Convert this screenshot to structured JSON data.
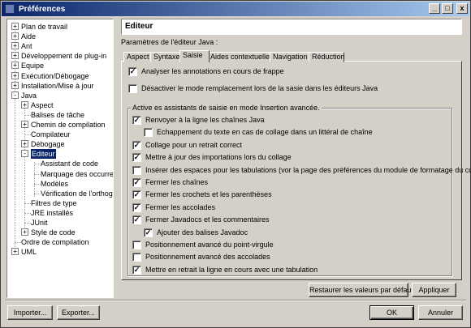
{
  "window": {
    "title": "Préférences",
    "minimize": "_",
    "maximize": "□",
    "close": "x"
  },
  "tree": [
    {
      "label": "Plan de travail",
      "expander": "+"
    },
    {
      "label": "Aide",
      "expander": "+"
    },
    {
      "label": "Ant",
      "expander": "+"
    },
    {
      "label": "Développement de plug-in",
      "expander": "+"
    },
    {
      "label": "Equipe",
      "expander": "+"
    },
    {
      "label": "Exécution/Débogage",
      "expander": "+"
    },
    {
      "label": "Installation/Mise à jour",
      "expander": "+"
    },
    {
      "label": "Java",
      "expander": "-"
    },
    {
      "label": "Aspect",
      "expander": "+"
    },
    {
      "label": "Balises de tâche",
      "expander": ""
    },
    {
      "label": "Chemin de compilation",
      "expander": "+"
    },
    {
      "label": "Compilateur",
      "expander": ""
    },
    {
      "label": "Débogage",
      "expander": "+"
    },
    {
      "label": "Editeur",
      "expander": "-"
    },
    {
      "label": "Assistant de code",
      "expander": ""
    },
    {
      "label": "Marquage des occurre",
      "expander": ""
    },
    {
      "label": "Modèles",
      "expander": ""
    },
    {
      "label": "Vérification de l'orthog",
      "expander": ""
    },
    {
      "label": "Filtres de type",
      "expander": ""
    },
    {
      "label": "JRE installés",
      "expander": ""
    },
    {
      "label": "JUnit",
      "expander": ""
    },
    {
      "label": "Style de code",
      "expander": "+"
    },
    {
      "label": "Ordre de compilation",
      "expander": ""
    },
    {
      "label": "UML",
      "expander": "+"
    }
  ],
  "page": {
    "heading": "Editeur",
    "params_label": "Paramètres de l'éditeur Java :"
  },
  "tabs": [
    "Aspect",
    "Syntaxe",
    "Saisie",
    "Aides contextuelles",
    "Navigation",
    "Réduction"
  ],
  "active_tab": "Saisie",
  "options": [
    {
      "label": "Analyser les annotations en cours de frappe",
      "checked": true
    },
    {
      "label": "Désactiver le mode remplacement lors de la sasie dans les éditeurs Java",
      "checked": false
    }
  ],
  "group": {
    "title": "Active es assistants de saisie en mode Insertion avancée.",
    "items": [
      {
        "label": "Renvoyer à la ligne les chaînes Java",
        "checked": true
      },
      {
        "label": "Echappement du texte en cas de collage dans un littéral de chaîne",
        "checked": false
      },
      {
        "label": "Collage pour un retrait correct",
        "checked": true
      },
      {
        "label": "Mettre à jour des importations lors du collage",
        "checked": true
      },
      {
        "label": "Insérer des espaces pour les tabulations (vor la page des préférences du module de formatage du code)",
        "checked": false
      },
      {
        "label": "Fermer les chaînes",
        "checked": true
      },
      {
        "label": "Fermer les crochets et les parenthèses",
        "checked": true
      },
      {
        "label": "Fermer les accolades",
        "checked": true
      },
      {
        "label": "Fermer Javadocs et les commentaires",
        "checked": true
      },
      {
        "label": "Ajouter des balises Javadoc",
        "checked": true
      },
      {
        "label": "Positionnement avancé du point-virgule",
        "checked": false
      },
      {
        "label": "Positionnement avancé des accolades",
        "checked": false
      },
      {
        "label": "Mettre en retrait la ligne en cours avec une tabulation",
        "checked": true
      }
    ]
  },
  "buttons": {
    "restore": "Restaurer les valeurs par défaut",
    "apply": "Appliquer",
    "import": "Importer...",
    "export": "Exporter...",
    "ok": "OK",
    "cancel": "Annuler"
  }
}
